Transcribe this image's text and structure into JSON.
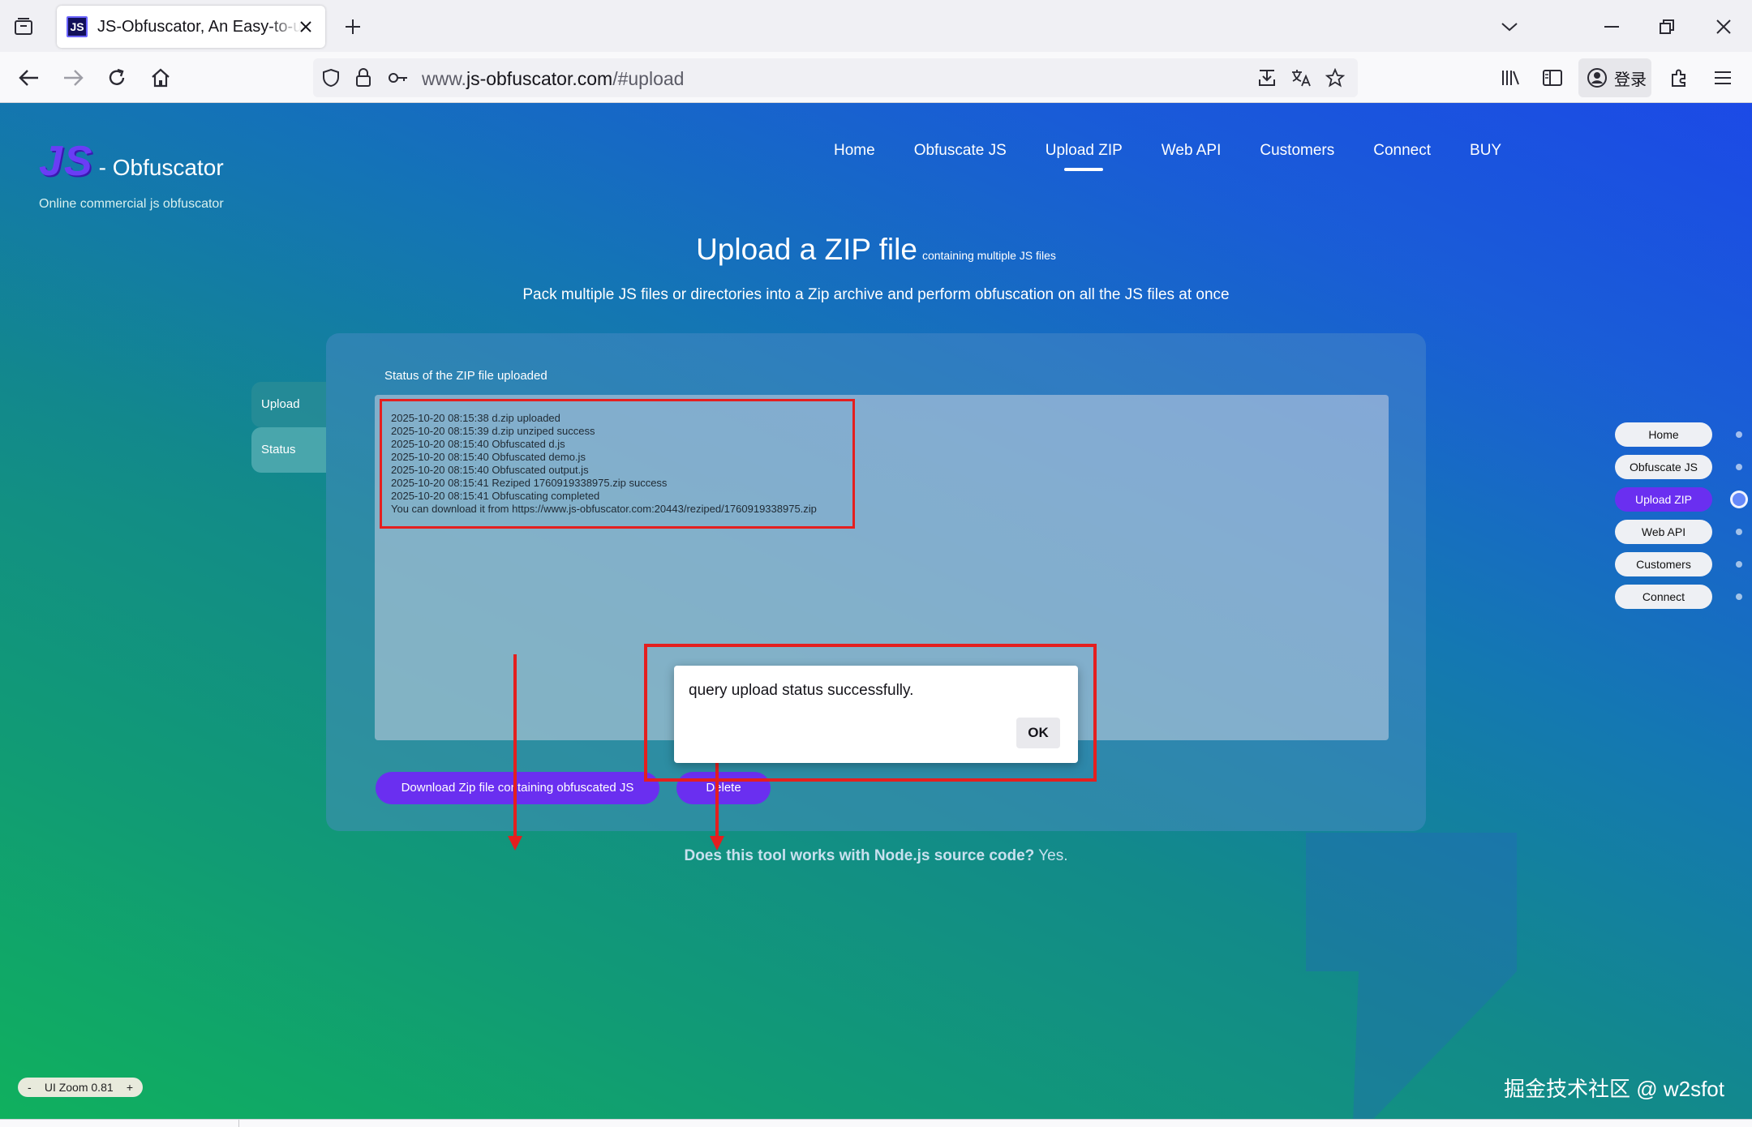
{
  "browser": {
    "tab_title": "JS-Obfuscator, An Easy-to-use",
    "favicon_text": "JS",
    "url_prefix": "www.",
    "url_domain": "js-obfuscator.com",
    "url_path": "/#upload",
    "account_label": "登录"
  },
  "site": {
    "logo_mark": "JS",
    "logo_text": "- Obfuscator",
    "tagline": "Online commercial js obfuscator",
    "nav": [
      {
        "label": "Home"
      },
      {
        "label": "Obfuscate JS"
      },
      {
        "label": "Upload ZIP"
      },
      {
        "label": "Web API"
      },
      {
        "label": "Customers"
      },
      {
        "label": "Connect"
      },
      {
        "label": "BUY"
      }
    ],
    "active_nav": "Upload ZIP"
  },
  "main": {
    "title": "Upload a ZIP file",
    "title_sub": "containing multiple JS files",
    "subtitle": "Pack multiple JS files or directories into a Zip archive and perform obfuscation on all the JS files at once",
    "side_tabs": [
      "Upload",
      "Status"
    ],
    "panel_title": "Status of the ZIP file uploaded",
    "log": [
      "2025-10-20 08:15:38 d.zip uploaded",
      "2025-10-20 08:15:39 d.zip unziped success",
      "2025-10-20 08:15:40 Obfuscated d.js",
      "2025-10-20 08:15:40 Obfuscated demo.js",
      "2025-10-20 08:15:40 Obfuscated output.js",
      "2025-10-20 08:15:41 Reziped 1760919338975.zip success",
      "2025-10-20 08:15:41 Obfuscating completed",
      "You can download it from https://www.js-obfuscator.com:20443/reziped/1760919338975.zip"
    ],
    "download_label": "Download Zip file containing obfuscated JS",
    "delete_label": "Delete",
    "faq_question": "Does this tool works with Node.js source code?",
    "faq_answer": " Yes."
  },
  "side_nav": [
    "Home",
    "Obfuscate JS",
    "Upload ZIP",
    "Web API",
    "Customers",
    "Connect"
  ],
  "dialog": {
    "message": "query upload status successfully.",
    "ok_label": "OK"
  },
  "zoom": {
    "minus": "-",
    "label": "UI Zoom 0.81",
    "plus": "+"
  },
  "watermark": "掘金技术社区 @ w2sfot",
  "colors": {
    "accent": "#6a2ff0",
    "highlight": "#e41f1f"
  }
}
